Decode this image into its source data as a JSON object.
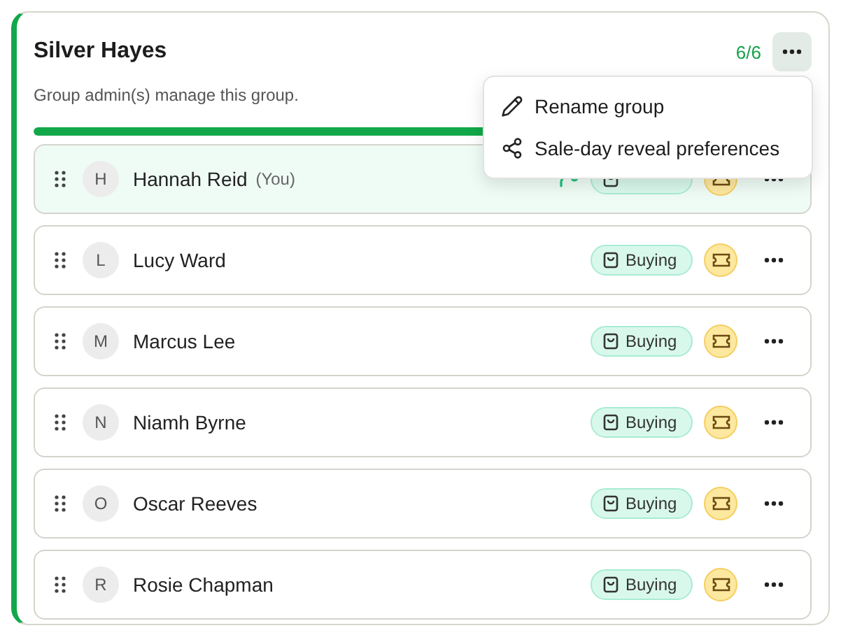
{
  "group": {
    "title": "Silver Hayes",
    "count": "6/6",
    "note": "Group admin(s) manage this group.",
    "level": 1
  },
  "menu": {
    "open": true,
    "items": [
      {
        "kind": "rename",
        "label": "Rename group"
      },
      {
        "kind": "share",
        "label": "Sale-day reveal preferences"
      }
    ]
  },
  "members": [
    {
      "initial": "H",
      "name": "Hannah Reid",
      "tag": "(You)",
      "selected": true,
      "admin": true
    },
    {
      "initial": "L",
      "name": "Lucy Ward",
      "selected": false,
      "admin": false,
      "status": "Buying"
    },
    {
      "initial": "M",
      "name": "Marcus Lee",
      "selected": false,
      "admin": false,
      "status": "Buying"
    },
    {
      "initial": "N",
      "name": "Niamh Byrne",
      "selected": false,
      "admin": false,
      "status": "Buying"
    },
    {
      "initial": "O",
      "name": "Oscar Reeves",
      "selected": false,
      "admin": false,
      "status": "Buying"
    },
    {
      "initial": "R",
      "name": "Rosie Chapman",
      "selected": false,
      "admin": false,
      "status": "Buying"
    }
  ]
}
